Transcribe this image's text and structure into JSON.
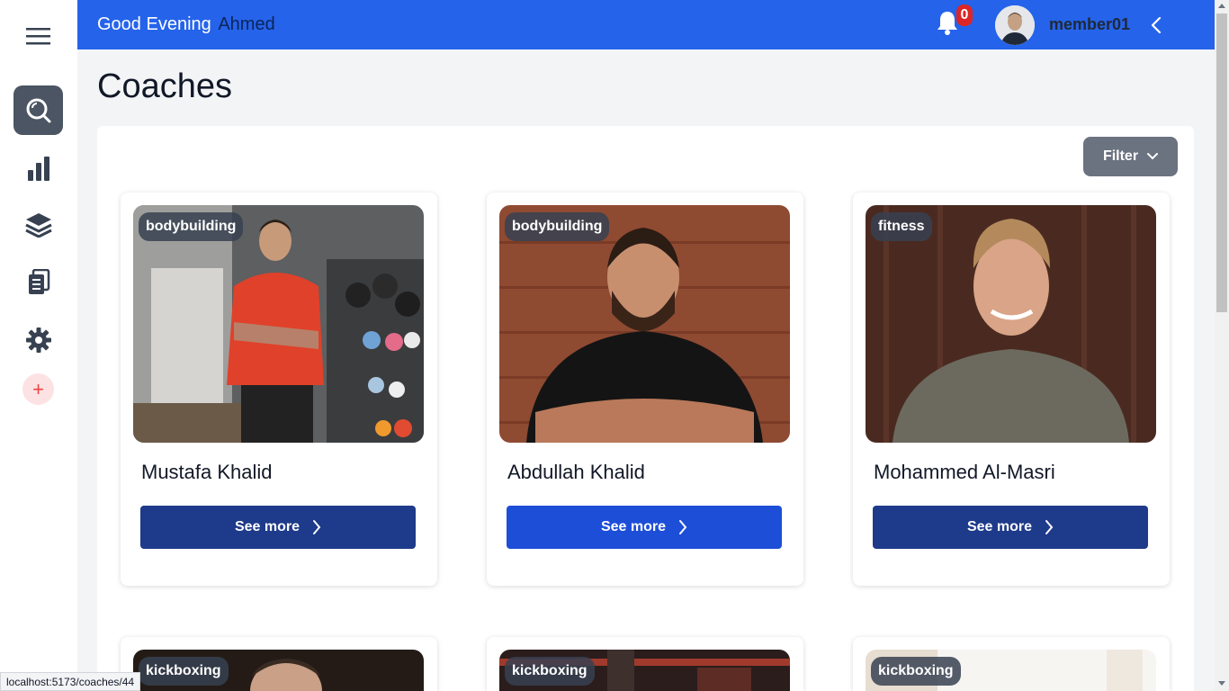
{
  "header": {
    "greeting": "Good Evening",
    "user_first_name": "Ahmed",
    "notification_count": "0",
    "username": "member01"
  },
  "sidebar": {
    "items": [
      {
        "name": "search-icon",
        "active": true
      },
      {
        "name": "bar-chart-icon",
        "active": false
      },
      {
        "name": "layers-icon",
        "active": false
      },
      {
        "name": "clipboard-icon",
        "active": false
      },
      {
        "name": "gear-icon",
        "active": false
      }
    ],
    "add_label": "+"
  },
  "page": {
    "title": "Coaches",
    "filter_label": "Filter"
  },
  "coaches": [
    {
      "tag": "bodybuilding",
      "name": "Mustafa Khalid",
      "button": "See more",
      "button_color": "#1e3a8a"
    },
    {
      "tag": "bodybuilding",
      "name": "Abdullah Khalid",
      "button": "See more",
      "button_color": "#1d4ed8"
    },
    {
      "tag": "fitness",
      "name": "Mohammed Al-Masri",
      "button": "See more",
      "button_color": "#1e3a8a"
    },
    {
      "tag": "kickboxing",
      "name": "",
      "button": "",
      "button_color": "#1e3a8a"
    },
    {
      "tag": "kickboxing",
      "name": "",
      "button": "",
      "button_color": "#1e3a8a"
    },
    {
      "tag": "kickboxing",
      "name": "",
      "button": "",
      "button_color": "#1e3a8a"
    }
  ],
  "status_url": "localhost:5173/coaches/44",
  "colors": {
    "header": "#2563eb",
    "active_nav": "#4b5563",
    "primary_button": "#1e3a8a",
    "hover_button": "#1d4ed8"
  }
}
